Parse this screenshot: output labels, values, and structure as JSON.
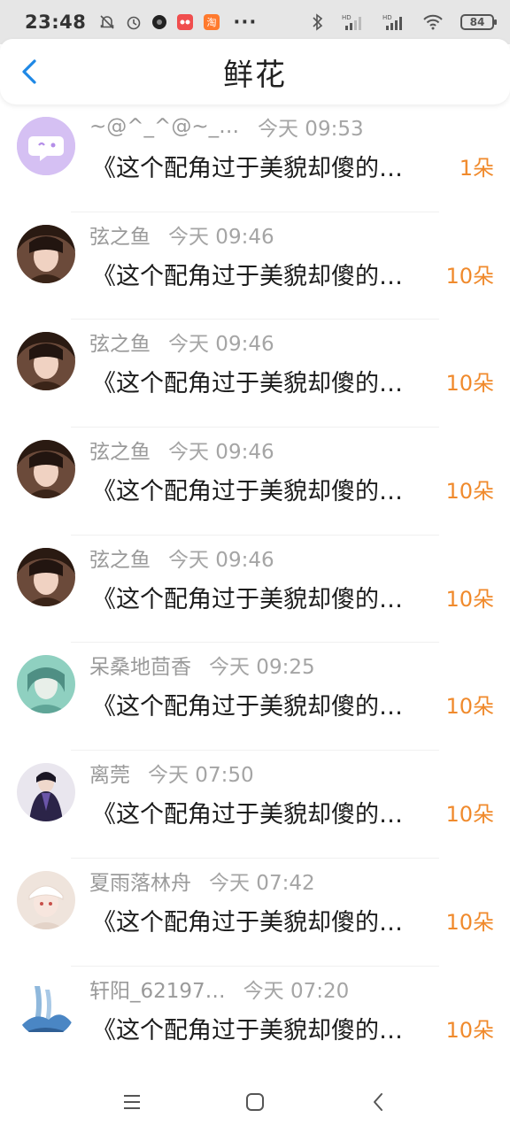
{
  "status_bar": {
    "time": "23:48",
    "dots": "···",
    "battery": "84"
  },
  "header": {
    "title": "鲜花"
  },
  "items": [
    {
      "name": "~@^_^@~_8…",
      "time": "今天 09:53",
      "content": "《这个配角过于美貌却傻的…",
      "count": "1朵",
      "avatar": "default-avatar"
    },
    {
      "name": "弦之鱼",
      "time": "今天 09:46",
      "content": "《这个配角过于美貌却傻的…",
      "count": "10朵",
      "avatar": "girl-dark"
    },
    {
      "name": "弦之鱼",
      "time": "今天 09:46",
      "content": "《这个配角过于美貌却傻的…",
      "count": "10朵",
      "avatar": "girl-dark"
    },
    {
      "name": "弦之鱼",
      "time": "今天 09:46",
      "content": "《这个配角过于美貌却傻的…",
      "count": "10朵",
      "avatar": "girl-dark"
    },
    {
      "name": "弦之鱼",
      "time": "今天 09:46",
      "content": "《这个配角过于美貌却傻的…",
      "count": "10朵",
      "avatar": "girl-dark"
    },
    {
      "name": "呆桑地茴香",
      "time": "今天 09:25",
      "content": "《这个配角过于美貌却傻的…",
      "count": "10朵",
      "avatar": "teal-girl"
    },
    {
      "name": "离莞",
      "time": "今天 07:50",
      "content": "《这个配角过于美貌却傻的…",
      "count": "10朵",
      "avatar": "dark-swordsman"
    },
    {
      "name": "夏雨落林舟",
      "time": "今天 07:42",
      "content": "《这个配角过于美貌却傻的…",
      "count": "10朵",
      "avatar": "white-hair-boy"
    },
    {
      "name": "轩阳_62197…",
      "time": "今天 07:20",
      "content": "《这个配角过于美貌却傻的…",
      "count": "10朵",
      "avatar": "blue-landscape"
    }
  ],
  "colors": {
    "accent_blue": "#1e88e5",
    "count_orange": "#f08a2c",
    "meta_gray": "#9a9a9a"
  }
}
